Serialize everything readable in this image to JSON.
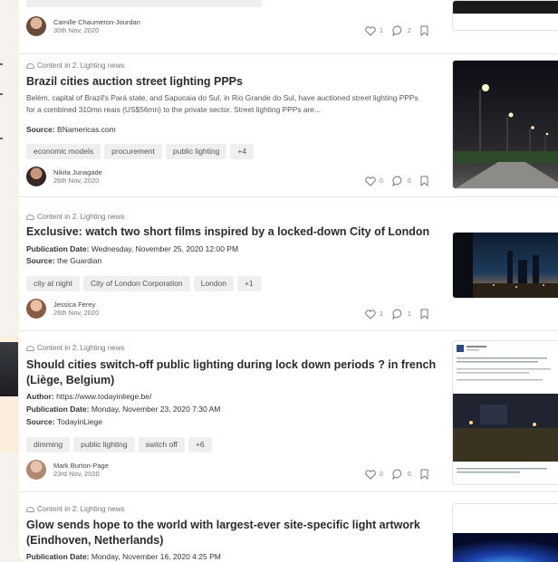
{
  "posts": [
    {
      "category": "",
      "title": "",
      "author": "Camille Chaumeron-Jourdan",
      "date": "30th Nov, 2020",
      "likes": "1",
      "comments": "2"
    },
    {
      "category": "Content in 2. Lighting news",
      "title": "Brazil cities auction street lighting PPPs",
      "excerpt": "Belém, capital of Brazil's Pará state, and Sapucaia do Sul, in Rio Grande do Sul, have auctioned street lighting PPPs for a combined 310mn reais (US$56mn) to the private sector. Street lighting PPPs are...",
      "source_label": "Source:",
      "source": "BNamericas.com",
      "tags": [
        "economic models",
        "procurement",
        "public lighting",
        "+4"
      ],
      "author": "Nikita Junagade",
      "date": "26th Nov, 2020",
      "likes": "0",
      "comments": "0"
    },
    {
      "category": "Content in 2. Lighting news",
      "title": "Exclusive: watch two short films inspired by a locked-down City of London",
      "pubdate_label": "Publication Date:",
      "pubdate": "Wednesday, November 25, 2020 12:00 PM",
      "source_label": "Source:",
      "source": "the Guardian",
      "tags": [
        "city at night",
        "City of London Corporation",
        "London",
        "+1"
      ],
      "author": "Jessica Ferey",
      "date": "26th Nov, 2020",
      "likes": "1",
      "comments": "1"
    },
    {
      "category": "Content in 2. Lighting news",
      "title_line1": "Should cities switch-off public lighting during lock down periods ? in french",
      "title_line2": "(Liège, Belgium)",
      "author_label": "Author:",
      "author_url": "https://www.todayinliege.be/",
      "pubdate_label": "Publication Date:",
      "pubdate": "Monday, November 23, 2020 7:30 AM",
      "source_label": "Source:",
      "source": "TodayinLiege",
      "tags": [
        "dimming",
        "public lighting",
        "switch off",
        "+6"
      ],
      "author": "Mark Burton-Page",
      "date": "23rd Nov, 2020",
      "likes": "0",
      "comments": "0"
    },
    {
      "category": "Content in 2. Lighting news",
      "title_line1": "Glow sends hope to the world with largest-ever site-specific light artwork",
      "title_line2": "(Eindhoven, Netherlands)",
      "pubdate_label": "Publication Date:",
      "pubdate": "Monday, November 16, 2020 4:25 PM"
    }
  ]
}
